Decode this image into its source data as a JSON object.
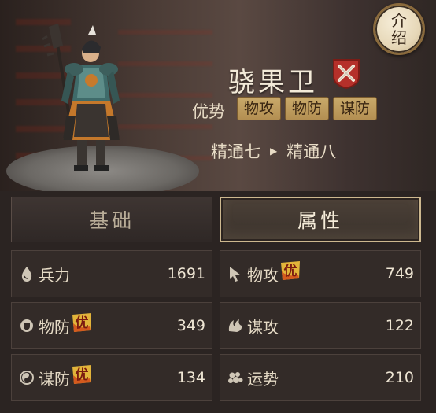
{
  "unit": {
    "name": "骁果卫",
    "advantage_label": "优势",
    "advantages": [
      "物攻",
      "物防",
      "谋防"
    ],
    "mastery_from": "精通七",
    "mastery_to": "精通八"
  },
  "intro_button": {
    "label": "介绍"
  },
  "tabs": [
    {
      "label": "基础",
      "active": false
    },
    {
      "label": "属性",
      "active": true
    }
  ],
  "badge_mark": "优",
  "stats": [
    {
      "label": "兵力",
      "value": "1691",
      "icon": "drop-icon",
      "advantage": false
    },
    {
      "label": "物攻",
      "value": "749",
      "icon": "cursor-arrow-icon",
      "advantage": true
    },
    {
      "label": "物防",
      "value": "349",
      "icon": "shield-icon",
      "advantage": true
    },
    {
      "label": "谋攻",
      "value": "122",
      "icon": "flame-icon",
      "advantage": false
    },
    {
      "label": "谋防",
      "value": "134",
      "icon": "taiji-icon",
      "advantage": true
    },
    {
      "label": "运势",
      "value": "210",
      "icon": "cloud-icon",
      "advantage": false
    }
  ],
  "colors": {
    "tag_gold": "#c9a96a",
    "active_tab_border": "#cdb88f",
    "badge_red": "#b5302a",
    "advantage_mark": "#e2b43a"
  }
}
